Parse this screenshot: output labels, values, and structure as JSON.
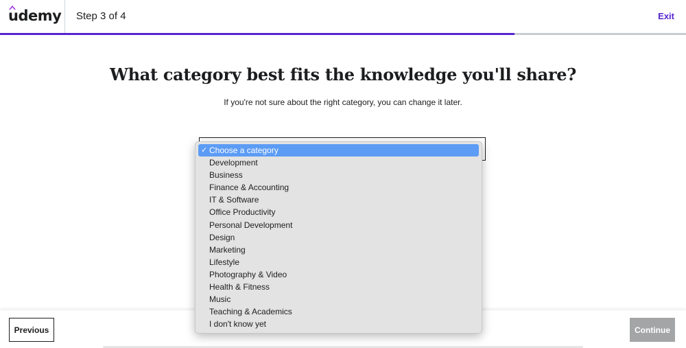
{
  "header": {
    "logo_text": "udemy",
    "step_label": "Step 3 of 4",
    "exit_label": "Exit"
  },
  "progress": {
    "fraction": 0.75
  },
  "colors": {
    "accent": "#5624d0",
    "selected_option": "#5c9cf5",
    "continue_disabled": "#a3a5a7"
  },
  "main": {
    "title": "What category best fits the knowledge you'll share?",
    "subtitle": "If you're not sure about the right category, you can change it later."
  },
  "category_select": {
    "selected": "Choose a category",
    "check_glyph": "✓",
    "options": [
      "Choose a category",
      "Development",
      "Business",
      "Finance & Accounting",
      "IT & Software",
      "Office Productivity",
      "Personal Development",
      "Design",
      "Marketing",
      "Lifestyle",
      "Photography & Video",
      "Health & Fitness",
      "Music",
      "Teaching & Academics",
      "I don't know yet"
    ]
  },
  "footer": {
    "previous_label": "Previous",
    "continue_label": "Continue"
  }
}
